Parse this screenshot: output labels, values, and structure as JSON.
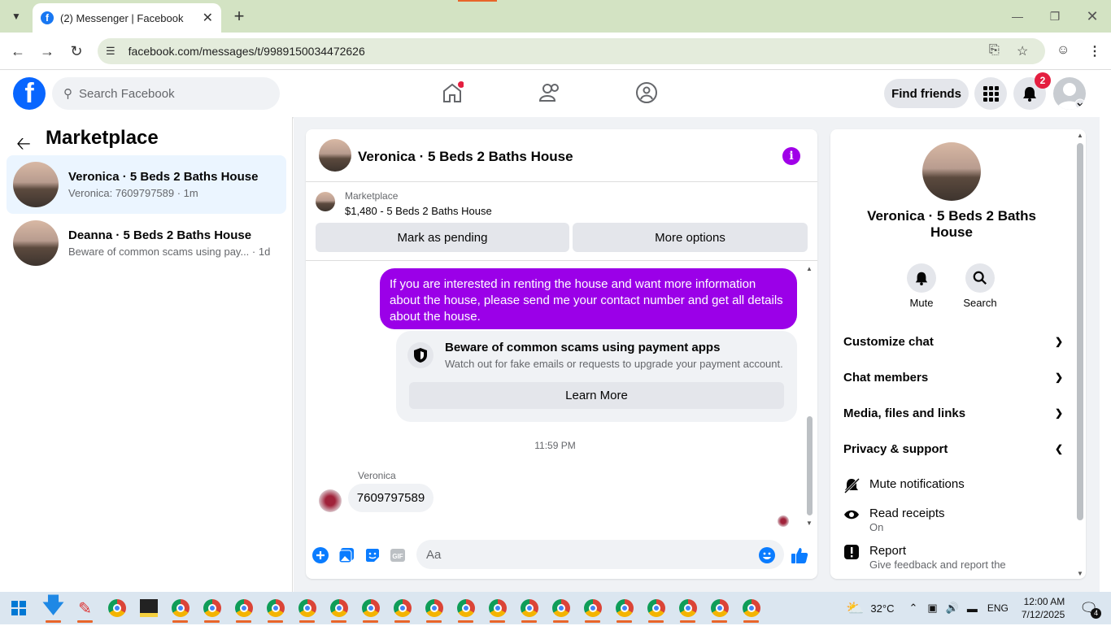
{
  "browser": {
    "tab_title": "(2) Messenger | Facebook",
    "url": "facebook.com/messages/t/9989150034472626"
  },
  "fb_header": {
    "search_placeholder": "Search Facebook",
    "find_friends": "Find friends",
    "notif_count": "2"
  },
  "left": {
    "title": "Marketplace",
    "conversations": [
      {
        "name": "Veronica · 5 Beds 2 Baths House",
        "preview": "Veronica: 7609797589 · 1m"
      },
      {
        "name": "Deanna · 5 Beds 2 Baths House",
        "preview": "Beware of common scams using pay...",
        "time": " · 1d"
      }
    ]
  },
  "chat": {
    "title": "Veronica · 5 Beds 2 Baths House",
    "marketplace_label": "Marketplace",
    "listing": "$1,480 - 5 Beds 2 Baths House",
    "mark_pending": "Mark as pending",
    "more_options": "More options",
    "outgoing_message": "If you are interested in renting the house and want more information about the house, please send me your contact number and get all details about the house.",
    "scam_title": "Beware of common scams using payment apps",
    "scam_text": "Watch out for fake emails or requests to upgrade your payment account.",
    "learn_more": "Learn More",
    "timestamp": "11:59 PM",
    "sender": "Veronica",
    "reply": "7609797589",
    "input_placeholder": "Aa"
  },
  "right": {
    "name": "Veronica · 5 Beds 2 Baths House",
    "mute": "Mute",
    "search": "Search",
    "sections": [
      "Customize chat",
      "Chat members",
      "Media, files and links",
      "Privacy & support"
    ],
    "mute_notifications": "Mute notifications",
    "read_receipts": "Read receipts",
    "read_receipts_state": "On",
    "report": "Report",
    "report_sub": "Give feedback and report the"
  },
  "taskbar": {
    "temperature": "32°C",
    "language": "ENG",
    "time": "12:00 AM",
    "date": "7/12/2025",
    "notifications": "4"
  },
  "colors": {
    "fb_blue": "#0866ff",
    "messenger_purple": "#9b00e8",
    "browser_chrome": "#d3e3c3"
  }
}
